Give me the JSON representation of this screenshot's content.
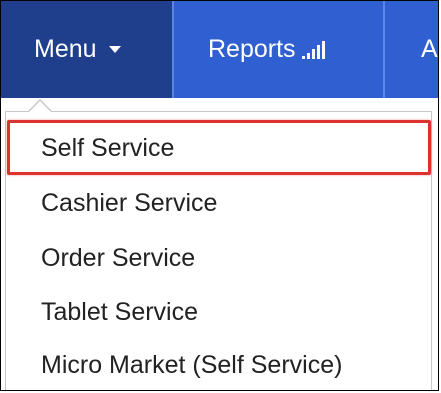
{
  "nav": {
    "menu_label": "Menu",
    "reports_label": "Reports",
    "third_label": "A"
  },
  "dropdown": {
    "items": [
      {
        "label": "Self Service",
        "highlighted": true
      },
      {
        "label": "Cashier Service"
      },
      {
        "label": "Order Service"
      },
      {
        "label": "Tablet Service"
      },
      {
        "label": "Micro Market (Self Service)"
      }
    ]
  },
  "colors": {
    "nav_active": "#1f3f8c",
    "nav_bg": "#2f5fd1",
    "highlight_border": "#e03131"
  },
  "icons": {
    "menu_caret": "caret-down-icon",
    "reports": "bar-chart-icon"
  }
}
